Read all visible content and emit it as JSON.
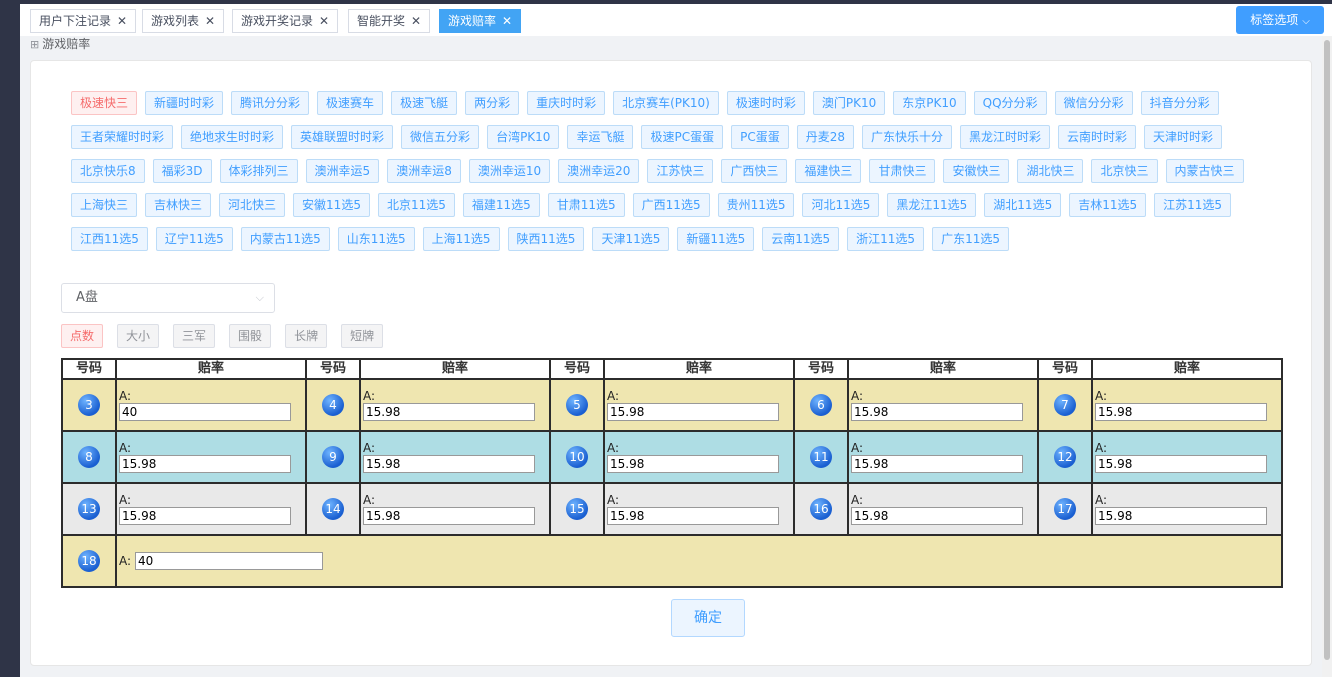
{
  "tabs": [
    {
      "label": "用户下注记录",
      "active": false
    },
    {
      "label": "游戏列表",
      "active": false
    },
    {
      "label": "游戏开奖记录",
      "active": false
    },
    {
      "label": "智能开奖",
      "active": false
    },
    {
      "label": "游戏赔率",
      "active": true
    }
  ],
  "tag_options": "标签选项",
  "page_title": "游戏赔率",
  "games": [
    "极速快三",
    "新疆时时彩",
    "腾讯分分彩",
    "极速赛车",
    "极速飞艇",
    "两分彩",
    "重庆时时彩",
    "北京赛车(PK10)",
    "极速时时彩",
    "澳门PK10",
    "东京PK10",
    "QQ分分彩",
    "微信分分彩",
    "抖音分分彩",
    "王者荣耀时时彩",
    "绝地求生时时彩",
    "英雄联盟时时彩",
    "微信五分彩",
    "台湾PK10",
    "幸运飞艇",
    "极速PC蛋蛋",
    "PC蛋蛋",
    "丹麦28",
    "广东快乐十分",
    "黑龙江时时彩",
    "云南时时彩",
    "天津时时彩",
    "北京快乐8",
    "福彩3D",
    "体彩排列三",
    "澳洲幸运5",
    "澳洲幸运8",
    "澳洲幸运10",
    "澳洲幸运20",
    "江苏快三",
    "广西快三",
    "福建快三",
    "甘肃快三",
    "安徽快三",
    "湖北快三",
    "北京快三",
    "内蒙古快三",
    "上海快三",
    "吉林快三",
    "河北快三",
    "安徽11选5",
    "北京11选5",
    "福建11选5",
    "甘肃11选5",
    "广西11选5",
    "贵州11选5",
    "河北11选5",
    "黑龙江11选5",
    "湖北11选5",
    "吉林11选5",
    "江苏11选5",
    "江西11选5",
    "辽宁11选5",
    "内蒙古11选5",
    "山东11选5",
    "上海11选5",
    "陕西11选5",
    "天津11选5",
    "新疆11选5",
    "云南11选5",
    "浙江11选5",
    "广东11选5"
  ],
  "active_game": "极速快三",
  "plate_select": "A盘",
  "bet_types": [
    {
      "label": "点数",
      "active": true
    },
    {
      "label": "大小",
      "active": false
    },
    {
      "label": "三军",
      "active": false
    },
    {
      "label": "围骰",
      "active": false
    },
    {
      "label": "长牌",
      "active": false
    },
    {
      "label": "短牌",
      "active": false
    }
  ],
  "table_headers": {
    "number": "号码",
    "odds": "赔率"
  },
  "odds_label": "A:",
  "odds_rows": [
    [
      {
        "n": "3",
        "v": "40"
      },
      {
        "n": "4",
        "v": "15.98"
      },
      {
        "n": "5",
        "v": "15.98"
      },
      {
        "n": "6",
        "v": "15.98"
      },
      {
        "n": "7",
        "v": "15.98"
      }
    ],
    [
      {
        "n": "8",
        "v": "15.98"
      },
      {
        "n": "9",
        "v": "15.98"
      },
      {
        "n": "10",
        "v": "15.98"
      },
      {
        "n": "11",
        "v": "15.98"
      },
      {
        "n": "12",
        "v": "15.98"
      }
    ],
    [
      {
        "n": "13",
        "v": "15.98"
      },
      {
        "n": "14",
        "v": "15.98"
      },
      {
        "n": "15",
        "v": "15.98"
      },
      {
        "n": "16",
        "v": "15.98"
      },
      {
        "n": "17",
        "v": "15.98"
      }
    ]
  ],
  "odds_last": {
    "n": "18",
    "v": "40"
  },
  "confirm_label": "确定",
  "colors": {
    "accent": "#409eff",
    "row_yellow": "#efe6b0",
    "row_cyan": "#aedde4",
    "row_gray": "#e9e9e9",
    "active_tag": "#f56c6c"
  }
}
